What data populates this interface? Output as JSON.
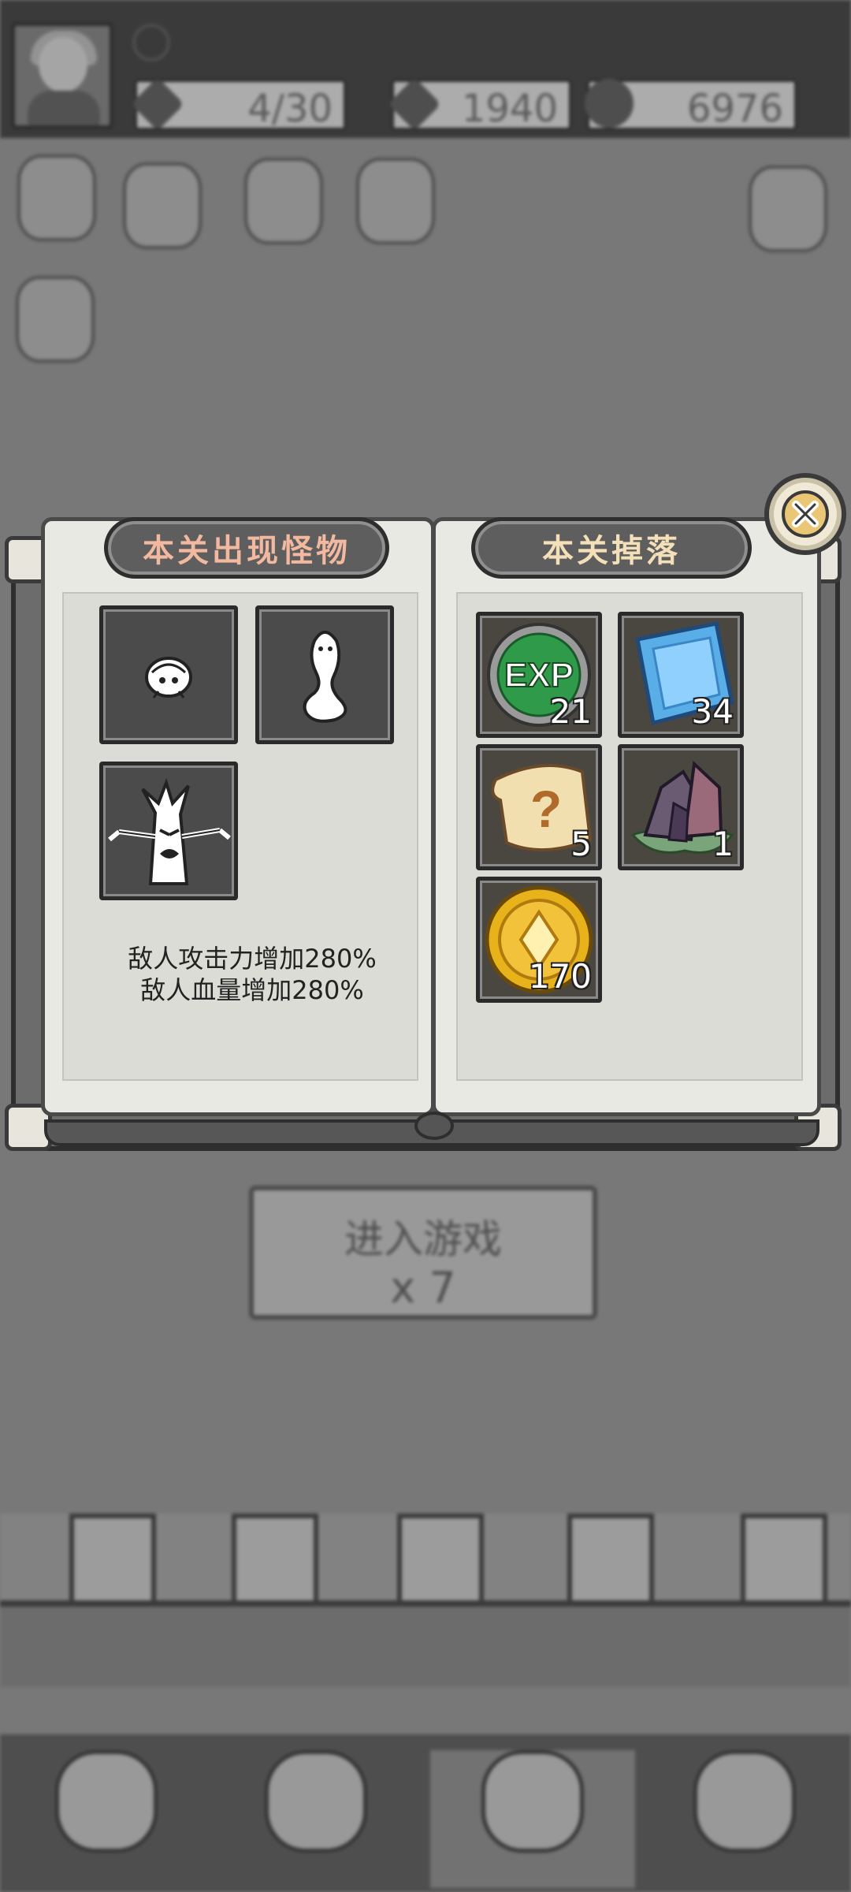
{
  "resources": {
    "energy": {
      "value": "4/30",
      "icon": "teal-gem-icon",
      "color": "#2aa18a"
    },
    "gems": {
      "value": "1940",
      "icon": "purple-gem-icon",
      "color": "#b03bd0"
    },
    "gold": {
      "value": "6976",
      "icon": "gold-coin-icon",
      "color": "#e0a400"
    }
  },
  "enter_button": {
    "label": "进入游戏",
    "cost": "x 7"
  },
  "modal": {
    "monsters_title": "本关出现怪物",
    "drops_title": "本关掉落",
    "monsters": [
      {
        "icon": "shell-creature-icon"
      },
      {
        "icon": "ghost-worm-icon"
      },
      {
        "icon": "angry-tree-icon"
      }
    ],
    "drops": [
      {
        "icon": "exp-orb-icon",
        "label": "EXP",
        "count": "21"
      },
      {
        "icon": "blue-crystal-icon",
        "count": "34"
      },
      {
        "icon": "mystery-scroll-icon",
        "count": "5"
      },
      {
        "icon": "dark-ore-icon",
        "count": "1"
      },
      {
        "icon": "gold-coin-icon",
        "count": "170"
      }
    ],
    "modifiers": [
      "敌人攻击力增加280%",
      "敌人血量增加280%"
    ]
  },
  "colors": {
    "monster_title": "#f2b9a0",
    "drop_title": "#f3e0b8",
    "exp_green": "#2f9a4a",
    "crystal_blue": "#5aaee8",
    "coin_gold": "#e8b31a"
  }
}
